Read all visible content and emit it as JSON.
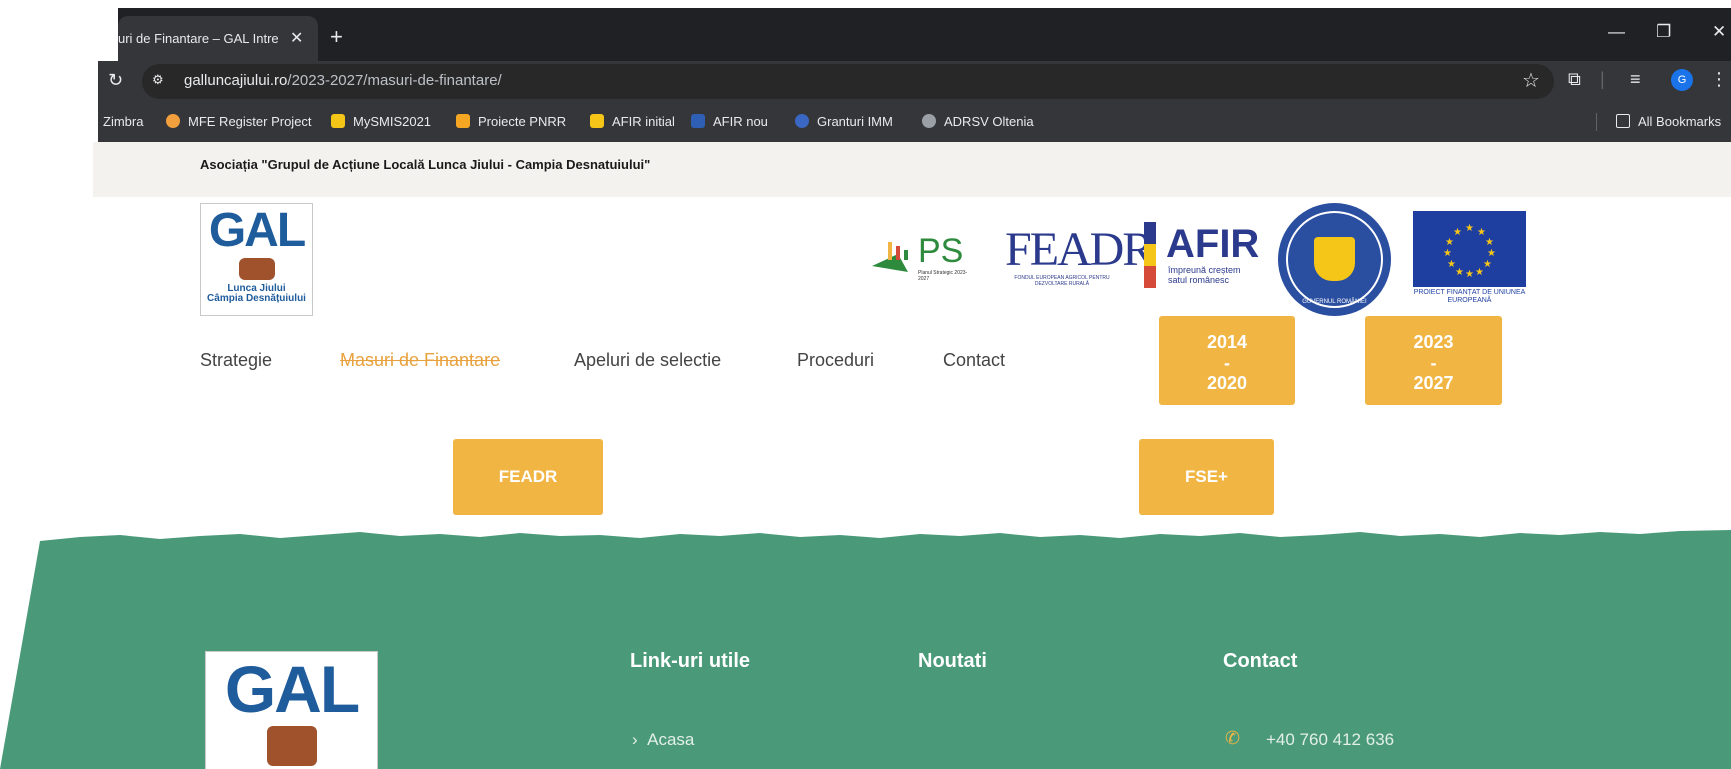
{
  "browser": {
    "tab_title": "uri de Finantare – GAL Intre",
    "close_glyph": "✕",
    "new_tab_glyph": "+",
    "window_controls": [
      "—",
      "❐",
      "✕"
    ],
    "url_host": "galluncajiului.ro",
    "url_path": "/2023-2027/masuri-de-finantare/",
    "profile_initial": "G",
    "bookmarks": [
      {
        "label": "Zimbra",
        "icon": "zimbra-icon",
        "color": "#35363a"
      },
      {
        "label": "MFE Register Project",
        "icon": "mfe-icon",
        "color": "#f2a03d"
      },
      {
        "label": "MySMIS2021",
        "icon": "mysmis-icon",
        "color": "#f5c518"
      },
      {
        "label": "Proiecte PNRR",
        "icon": "pnrr-icon",
        "color": "#f5a623"
      },
      {
        "label": "AFIR initial",
        "icon": "afir-icon",
        "color": "#f5c518"
      },
      {
        "label": "AFIR nou",
        "icon": "afir-nou-icon",
        "color": "#2f5fb4"
      },
      {
        "label": "Granturi IMM",
        "icon": "imm-icon",
        "color": "#3a66c4"
      },
      {
        "label": "ADRSV Oltenia",
        "icon": "globe-icon",
        "color": "#9aa0a6"
      }
    ],
    "all_bookmarks": "All Bookmarks"
  },
  "page": {
    "association": "Asociația \"Grupul de Acțiune Locală Lunca Jiului - Campia Desnatuiului\"",
    "logo": {
      "gal": "GAL",
      "line1": "Lunca Jiului",
      "line2": "Câmpia Desnățuiului"
    },
    "partners": {
      "ps": "PS",
      "ps_sub": "Planul Strategic 2023-2027",
      "feadr": "FEADR",
      "feadr_sub": "FONDUL EUROPEAN AGRICOL PENTRU DEZVOLTARE RURALĂ",
      "afir": "AFIR",
      "afir_sub": "împreună creștem satul românesc",
      "gov": "GUVERNUL ROMÂNIEI",
      "eu": "PROIECT FINANȚAT DE UNIUNEA EUROPEANĂ"
    },
    "nav": [
      "Strategie",
      "Masuri de Finantare",
      "Apeluri de selectie",
      "Proceduri",
      "Contact"
    ],
    "periods": [
      {
        "top": "2014",
        "dash": "-",
        "bottom": "2020"
      },
      {
        "top": "2023",
        "dash": "-",
        "bottom": "2027"
      }
    ],
    "funds": [
      "FEADR",
      "FSE+"
    ],
    "accent": "#f0b543",
    "footer_green": "#4a9a7a"
  },
  "footer": {
    "links_title": "Link-uri utile",
    "news_title": "Noutati",
    "contact_title": "Contact",
    "link_home": "Acasa",
    "phone": "+40 760 412 636",
    "logo": {
      "gal": "GAL"
    }
  }
}
